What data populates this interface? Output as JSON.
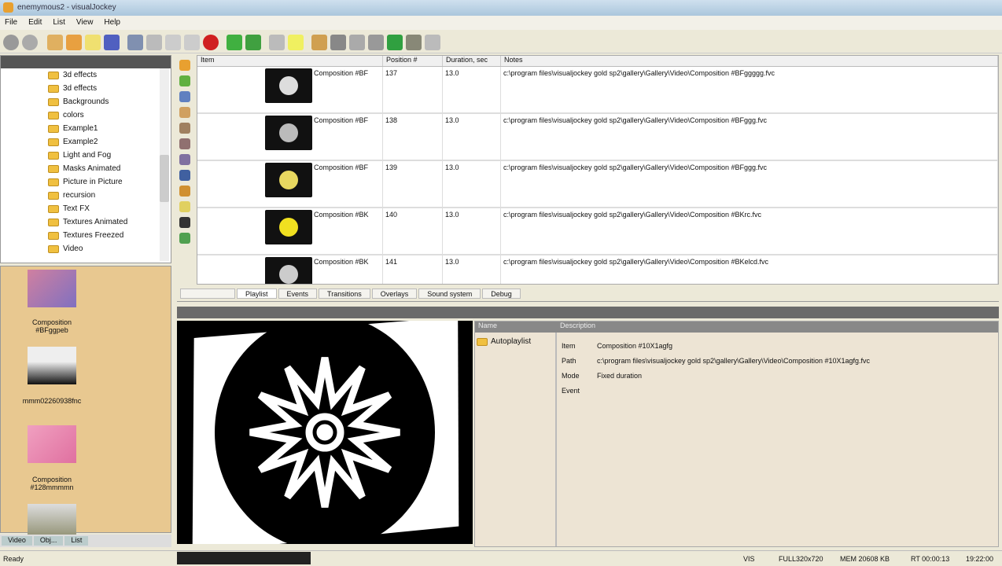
{
  "window": {
    "title": "enemymous2 - visualJockey"
  },
  "menu": [
    "File",
    "Edit",
    "List",
    "View",
    "Help"
  ],
  "tree": [
    "3d effects",
    "3d effects",
    "Backgrounds",
    "colors",
    "Example1",
    "Example2",
    "Light and Fog",
    "Masks Animated",
    "Picture in Picture",
    "recursion",
    "Text FX",
    "Textures Animated",
    "Textures Freezed",
    "Video"
  ],
  "thumbs": [
    "Composition #BFggpeb",
    "mmm02260938fnc",
    "Composition #128mmmmn"
  ],
  "left_tabs": [
    "Video",
    "Obj...",
    "List"
  ],
  "table": {
    "columns": [
      "Item",
      "Position #",
      "Duration, sec",
      "Notes"
    ],
    "rows": [
      {
        "item": "Composition #BF",
        "pos": "137",
        "dur": "13.0",
        "note": "c:\\program files\\visualjockey gold sp2\\gallery\\Gallery\\Video\\Composition #BFggggg.fvc",
        "color": "#ddd"
      },
      {
        "item": "Composition #BF",
        "pos": "138",
        "dur": "13.0",
        "note": "c:\\program files\\visualjockey gold sp2\\gallery\\Gallery\\Video\\Composition #BFggg.fvc",
        "color": "#bbb"
      },
      {
        "item": "Composition #BF",
        "pos": "139",
        "dur": "13.0",
        "note": "c:\\program files\\visualjockey gold sp2\\gallery\\Gallery\\Video\\Composition #BFggg.fvc",
        "color": "#e8d860"
      },
      {
        "item": "Composition #BK",
        "pos": "140",
        "dur": "13.0",
        "note": "c:\\program files\\visualjockey gold sp2\\gallery\\Gallery\\Video\\Composition #BKrc.fvc",
        "color": "#f0e020"
      },
      {
        "item": "Composition #BK",
        "pos": "141",
        "dur": "13.0",
        "note": "c:\\program files\\visualjockey gold sp2\\gallery\\Gallery\\Video\\Composition #BKelcd.fvc",
        "color": "#ccc"
      }
    ]
  },
  "tabs": [
    "Playlist",
    "Events",
    "Transitions",
    "Overlays",
    "Sound system",
    "Debug"
  ],
  "props": {
    "headers": [
      "Name",
      "Description"
    ],
    "node": "Autoplaylist",
    "rows": [
      {
        "k": "Item",
        "v": "Composition #10X1agfg"
      },
      {
        "k": "Path",
        "v": "c:\\program files\\visualjockey gold sp2\\gallery\\Gallery\\Video\\Composition #10X1agfg.fvc"
      },
      {
        "k": "Mode",
        "v": "Fixed duration"
      },
      {
        "k": "Event",
        "v": ""
      }
    ]
  },
  "status": {
    "left": "Ready",
    "fields": [
      "VIS",
      "FULL320x720",
      "MEM 20608 KB",
      "RT 00:00:13",
      "19:22:00"
    ]
  }
}
